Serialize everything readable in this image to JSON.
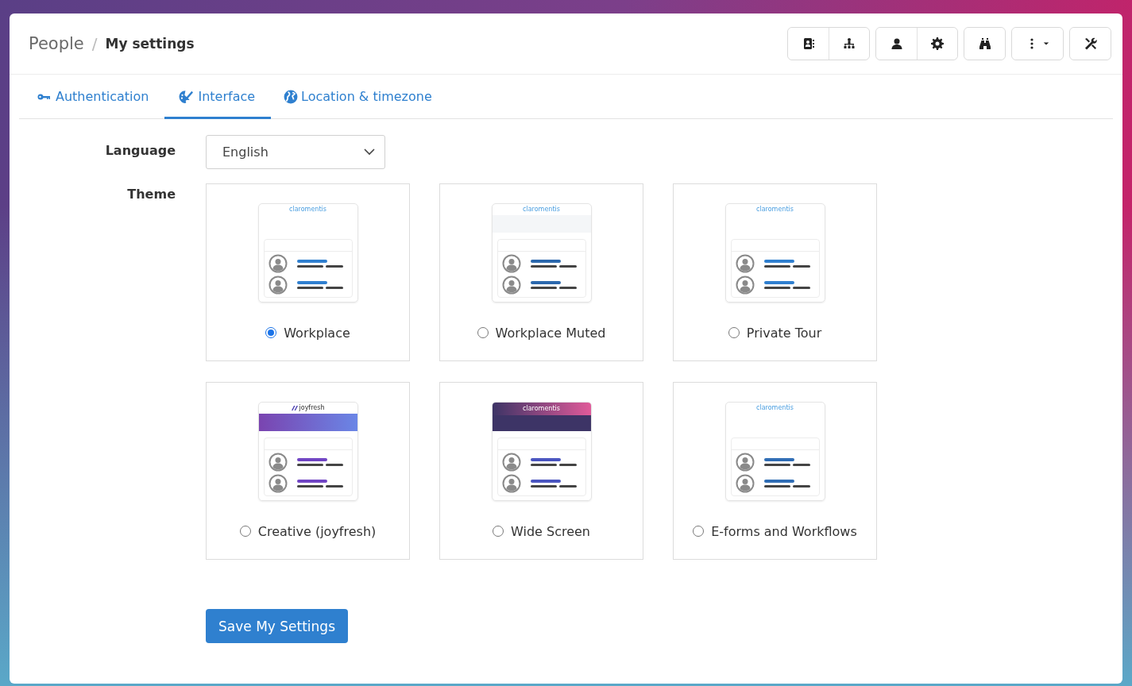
{
  "breadcrumb": {
    "parent": "People",
    "separator": "/",
    "current": "My settings"
  },
  "tabs": [
    {
      "label": "Authentication",
      "selected": false
    },
    {
      "label": "Interface",
      "selected": true
    },
    {
      "label": "Location & timezone",
      "selected": false
    }
  ],
  "language": {
    "label": "Language",
    "value": "English"
  },
  "theme": {
    "label": "Theme",
    "options": [
      {
        "name": "Workplace",
        "selected": true,
        "preview": {
          "kind": "plain",
          "logo": "claromentis",
          "color": "#2f7fcf"
        }
      },
      {
        "name": "Workplace Muted",
        "selected": false,
        "preview": {
          "kind": "muted",
          "logo": "claromentis",
          "color": "#2b68ad"
        }
      },
      {
        "name": "Private Tour",
        "selected": false,
        "preview": {
          "kind": "plain",
          "logo": "claromentis",
          "color": "#2f7fcf"
        }
      },
      {
        "name": "Creative (joyfresh)",
        "selected": false,
        "preview": {
          "kind": "gradient",
          "logo": "joyfresh",
          "color": "#7044c4"
        }
      },
      {
        "name": "Wide Screen",
        "selected": false,
        "preview": {
          "kind": "dark",
          "logo": "claromentis",
          "color": "#4a55c0"
        }
      },
      {
        "name": "E-forms and Workflows",
        "selected": false,
        "preview": {
          "kind": "plain",
          "logo": "claromentis",
          "color": "#2f6db5"
        }
      }
    ]
  },
  "save_button": "Save My Settings"
}
